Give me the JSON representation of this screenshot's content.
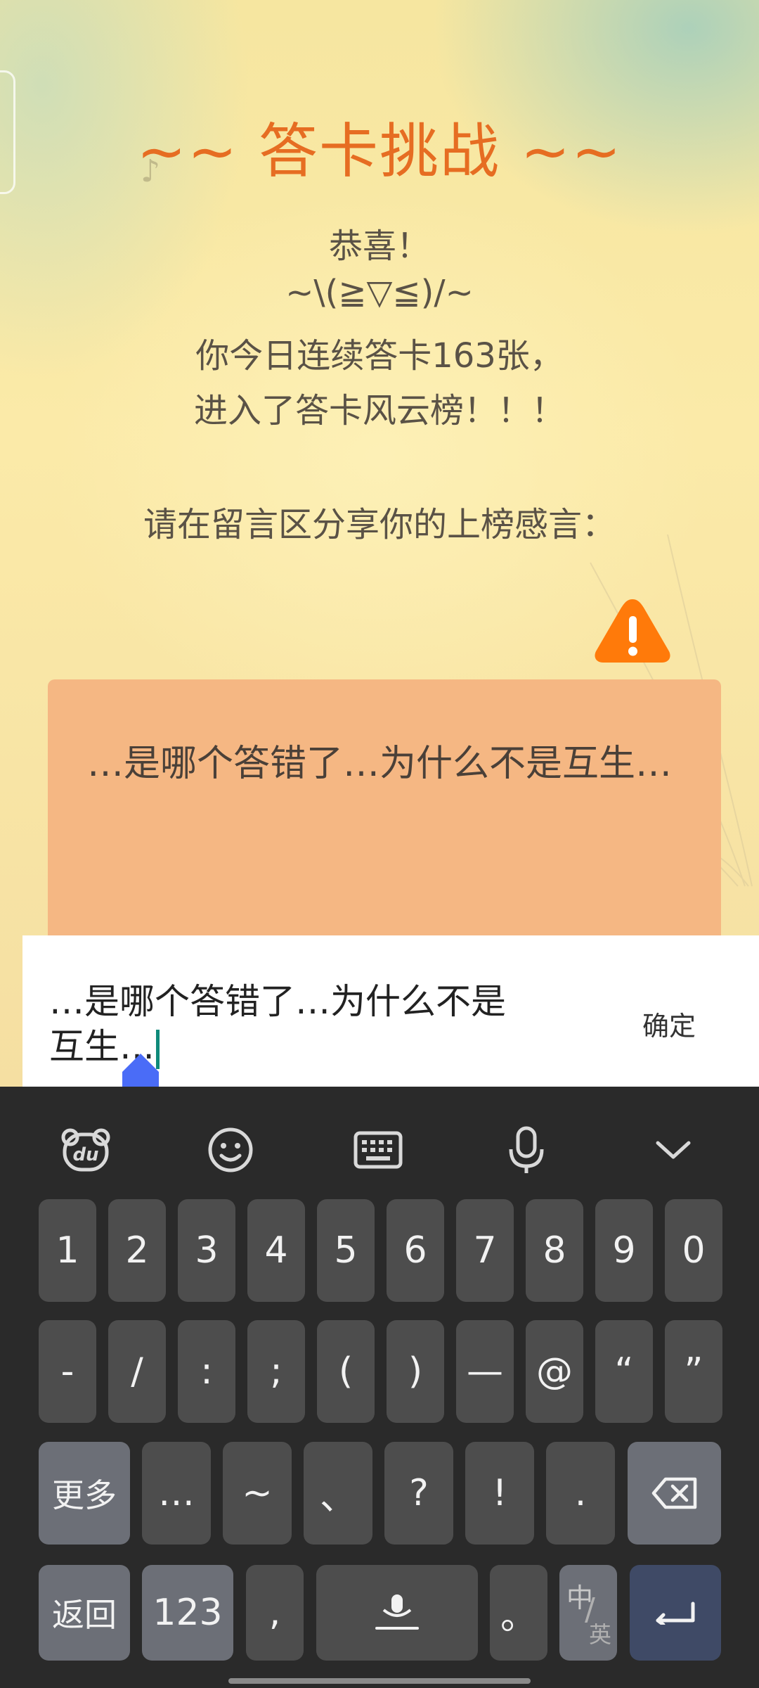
{
  "title": "~~ 答卡挑战 ~~",
  "message": {
    "line1": "恭喜！",
    "line2": "~\\(≧▽≦)/~",
    "line3": "你今日连续答卡163张，",
    "line4": "进入了答卡风云榜！！！",
    "prompt": "请在留言区分享你的上榜感言："
  },
  "card": {
    "text": "…是哪个答错了…为什么不是互生…"
  },
  "input": {
    "line1": "…是哪个答错了…为什么不是",
    "line2": "互生…",
    "confirm_label": "确定"
  },
  "keyboard": {
    "toolbar": [
      "baidu-du-icon",
      "emoji-icon",
      "keyboard-icon",
      "microphone-icon",
      "chevron-down-icon"
    ],
    "row1": [
      "1",
      "2",
      "3",
      "4",
      "5",
      "6",
      "7",
      "8",
      "9",
      "0"
    ],
    "row2": [
      "-",
      "/",
      ":",
      ";",
      "(",
      ")",
      "—",
      "@",
      "“",
      "”"
    ],
    "row3": [
      "更多",
      "…",
      "~",
      "、",
      "?",
      "!",
      "."
    ],
    "row4": {
      "back": "返回",
      "num": "123",
      "comma": ",",
      "period": "。",
      "lang_top": "中",
      "lang_bottom": "英"
    }
  },
  "colors": {
    "title": "#e66d22",
    "card": "#f5b783",
    "warning": "#ff7a0a",
    "keyboard_bg": "#2a2a2a",
    "key": "#4d4d4d",
    "cursor_handle": "#4a6cf7"
  }
}
